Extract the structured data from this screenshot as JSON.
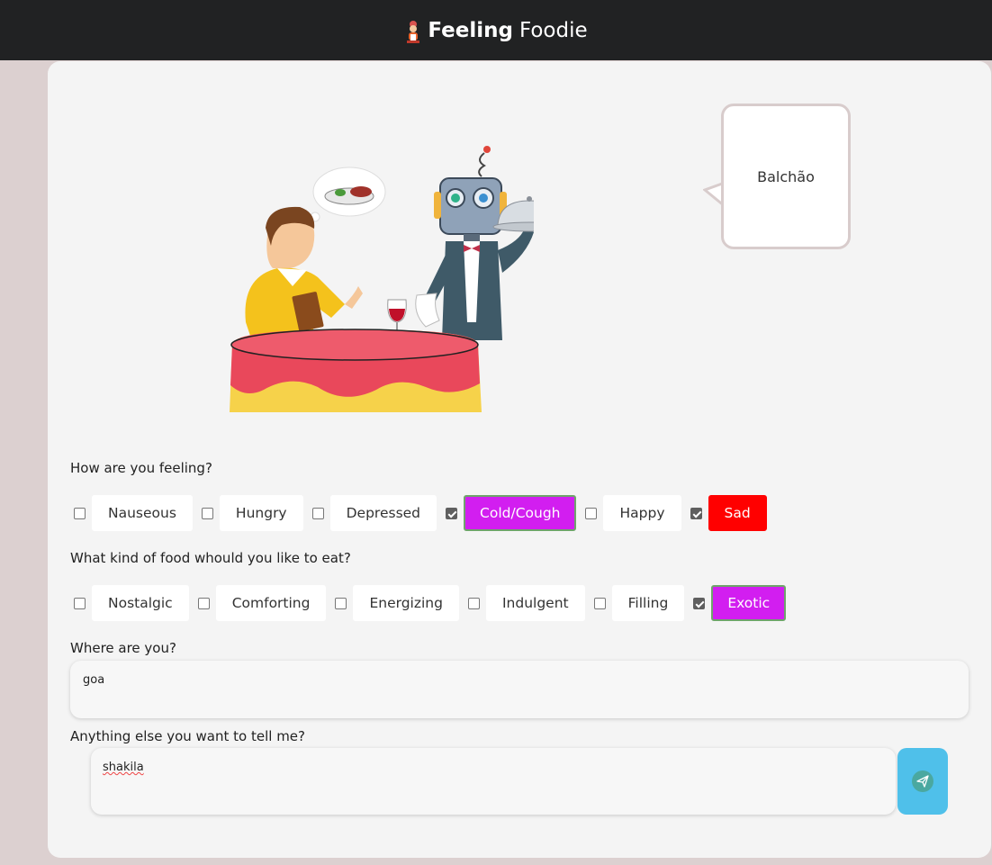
{
  "header": {
    "title_bold": "Feeling",
    "title_light": "Foodie",
    "logo_icon": "chef-icon"
  },
  "response_bubble": {
    "text": "Balchão"
  },
  "feeling_question": "How are you feeling?",
  "feelings": [
    {
      "label": "Nauseous",
      "checked": false,
      "style": "plain"
    },
    {
      "label": "Hungry",
      "checked": false,
      "style": "plain"
    },
    {
      "label": "Depressed",
      "checked": false,
      "style": "plain"
    },
    {
      "label": "Cold/Cough",
      "checked": true,
      "style": "magenta"
    },
    {
      "label": "Happy",
      "checked": false,
      "style": "plain"
    },
    {
      "label": "Sad",
      "checked": true,
      "style": "red"
    }
  ],
  "food_question": "What kind of food whould you like to eat?",
  "foods": [
    {
      "label": "Nostalgic",
      "checked": false,
      "style": "plain"
    },
    {
      "label": "Comforting",
      "checked": false,
      "style": "plain"
    },
    {
      "label": "Energizing",
      "checked": false,
      "style": "plain"
    },
    {
      "label": "Indulgent",
      "checked": false,
      "style": "plain"
    },
    {
      "label": "Filling",
      "checked": false,
      "style": "plain"
    },
    {
      "label": "Exotic",
      "checked": true,
      "style": "magenta"
    }
  ],
  "location_question": "Where are you?",
  "location_value": "goa",
  "extra_question": "Anything else you want to tell me?",
  "extra_value": "shakila",
  "send_icon": "send-icon",
  "colors": {
    "accent_magenta": "#d21ef0",
    "accent_red": "#ff0000",
    "send_button": "#4fc0ea",
    "header_bg": "#212223"
  }
}
